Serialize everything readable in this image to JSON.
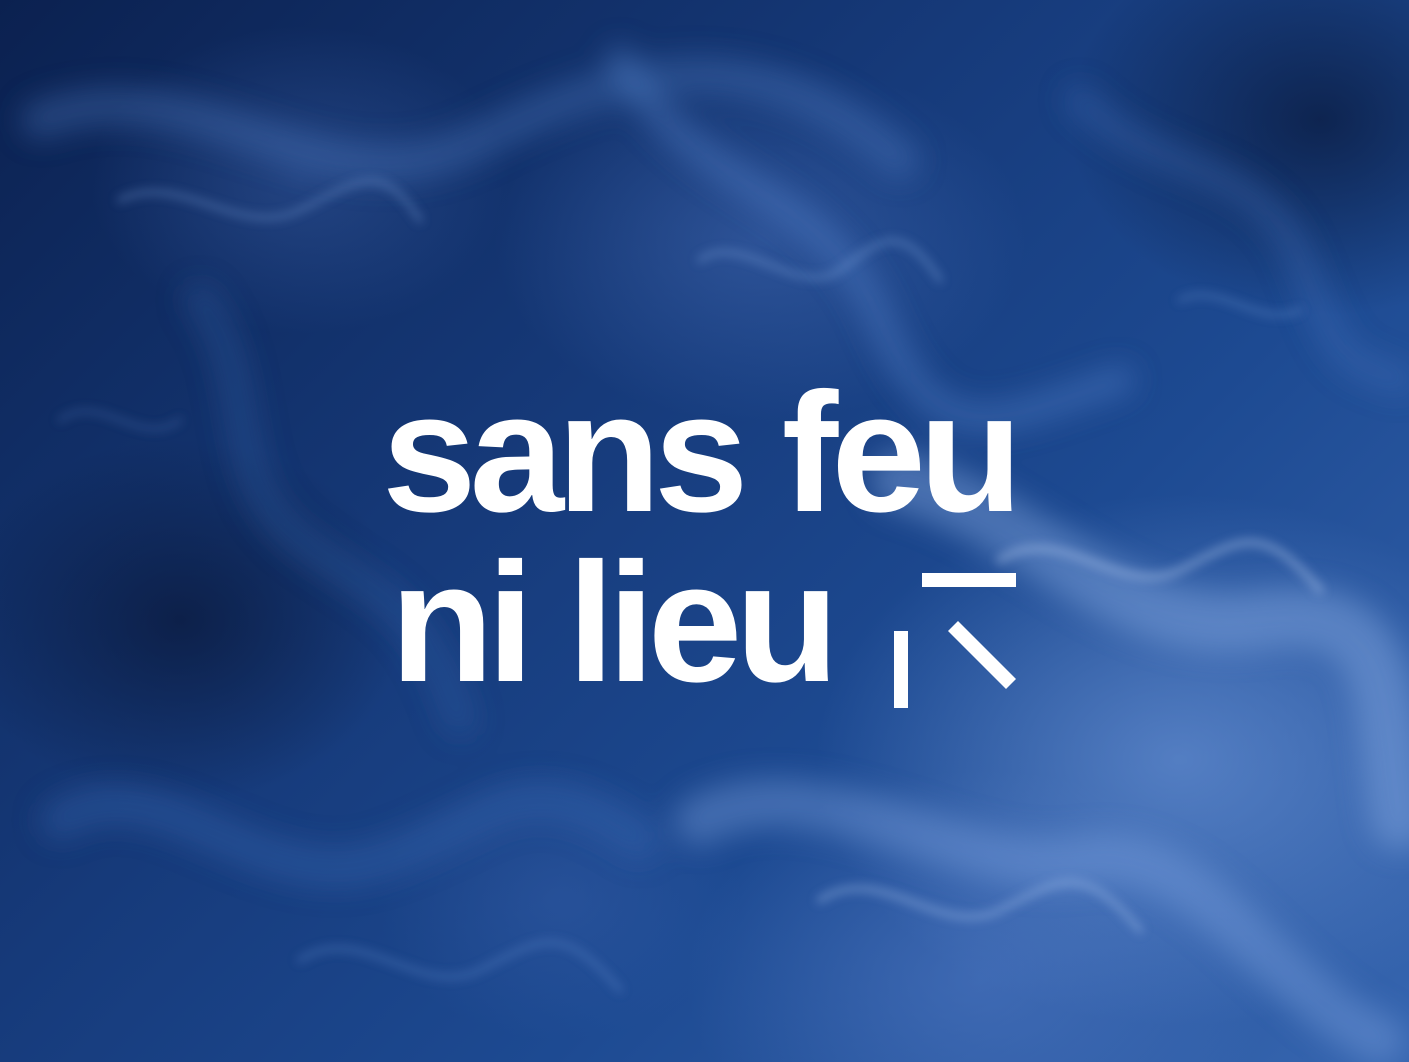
{
  "background": {
    "description_colors": {
      "deep": "#0b2150",
      "mid": "#1d4a92",
      "light": "#6f98d8"
    }
  },
  "logo": {
    "line1": "sans feu",
    "line2": "ni lieu",
    "mark_icon": "broken-bracket-icon",
    "color": "#ffffff"
  }
}
